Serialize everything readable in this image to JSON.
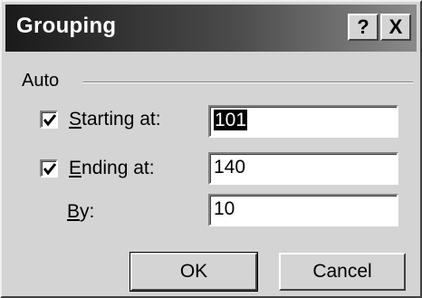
{
  "dialog": {
    "title": "Grouping",
    "help_label": "?",
    "close_label": "X"
  },
  "auto_group": {
    "label": "Auto"
  },
  "starting": {
    "label_mnemonic": "S",
    "label_rest": "tarting at:",
    "checked": true,
    "value": "101"
  },
  "ending": {
    "label_mnemonic": "E",
    "label_rest": "nding at:",
    "checked": true,
    "value": "140"
  },
  "by": {
    "label_mnemonic": "B",
    "label_rest": "y:",
    "value": "10"
  },
  "buttons": {
    "ok_label": "OK",
    "cancel_label": "Cancel"
  }
}
